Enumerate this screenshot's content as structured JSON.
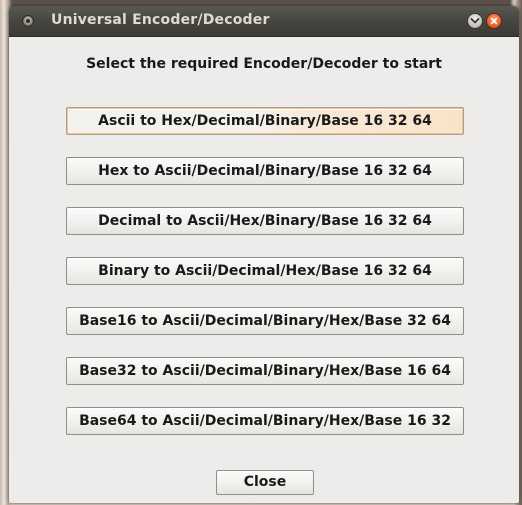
{
  "window": {
    "title": "Universal Encoder/Decoder"
  },
  "main": {
    "prompt": "Select the required Encoder/Decoder to start",
    "buttons": [
      {
        "label": "Ascii to Hex/Decimal/Binary/Base 16 32 64"
      },
      {
        "label": "Hex to Ascii/Decimal/Binary/Base 16 32 64"
      },
      {
        "label": "Decimal to Ascii/Hex/Binary/Base 16 32 64"
      },
      {
        "label": "Binary to Ascii/Decimal/Hex/Base 16 32 64"
      },
      {
        "label": "Base16 to Ascii/Decimal/Binary/Hex/Base 32 64"
      },
      {
        "label": "Base32 to Ascii/Decimal/Binary/Hex/Base 16 64"
      },
      {
        "label": "Base64 to Ascii/Decimal/Binary/Hex/Base 16 32"
      }
    ],
    "close_label": "Close"
  },
  "icons": {
    "window_menu": "window-menu-icon",
    "minimize": "minimize-chevron-icon",
    "close": "close-x-icon"
  },
  "colors": {
    "titlebar": "#46453f",
    "client_background": "#edeceb",
    "close_button_accent": "#f0612a",
    "focus_highlight": "#f1c48e"
  }
}
